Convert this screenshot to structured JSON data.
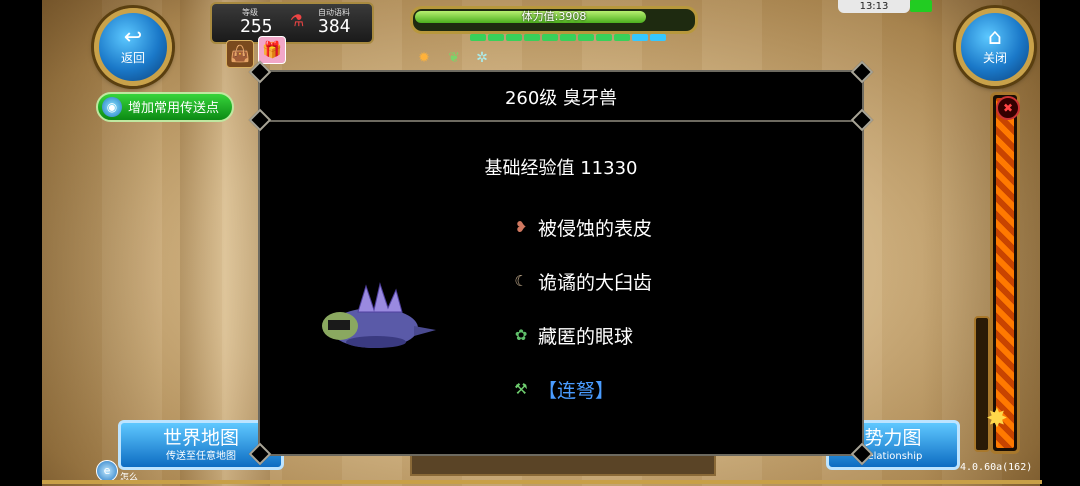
{
  "top_left": {
    "back_label": "返回",
    "level_label": "等级",
    "level_value": "255",
    "auto_potion_label": "自动语料",
    "auto_potion_value": "384"
  },
  "stamina": {
    "label": "体力值:3908",
    "fill_fraction": 0.85
  },
  "status": {
    "time": "13:13"
  },
  "top_right": {
    "close_label": "关闭"
  },
  "teleport_button": {
    "label": "增加常用传送点"
  },
  "modal": {
    "title": "260级 臭牙兽",
    "exp_line": "基础经验值 11330",
    "drops": [
      {
        "name": "被侵蚀的表皮",
        "icon": "hide-icon",
        "kind": "item"
      },
      {
        "name": "诡谲的大臼齿",
        "icon": "tooth-icon",
        "kind": "item"
      },
      {
        "name": "藏匿的眼球",
        "icon": "eyeball-icon",
        "kind": "item"
      },
      {
        "name": "【连弩】",
        "icon": "crossbow-icon",
        "kind": "skill"
      }
    ]
  },
  "bottom": {
    "world_map_title": "世界地图",
    "world_map_sub": "传送至任意地图",
    "faction_title": "势力图",
    "faction_sub": "relationship",
    "corner_label": "怎么",
    "version": "4.0.60a(162)"
  },
  "colors": {
    "accent_blue": "#1a78c8",
    "stamina_green": "#4caf1e",
    "skill_blue": "#4a9cff"
  }
}
